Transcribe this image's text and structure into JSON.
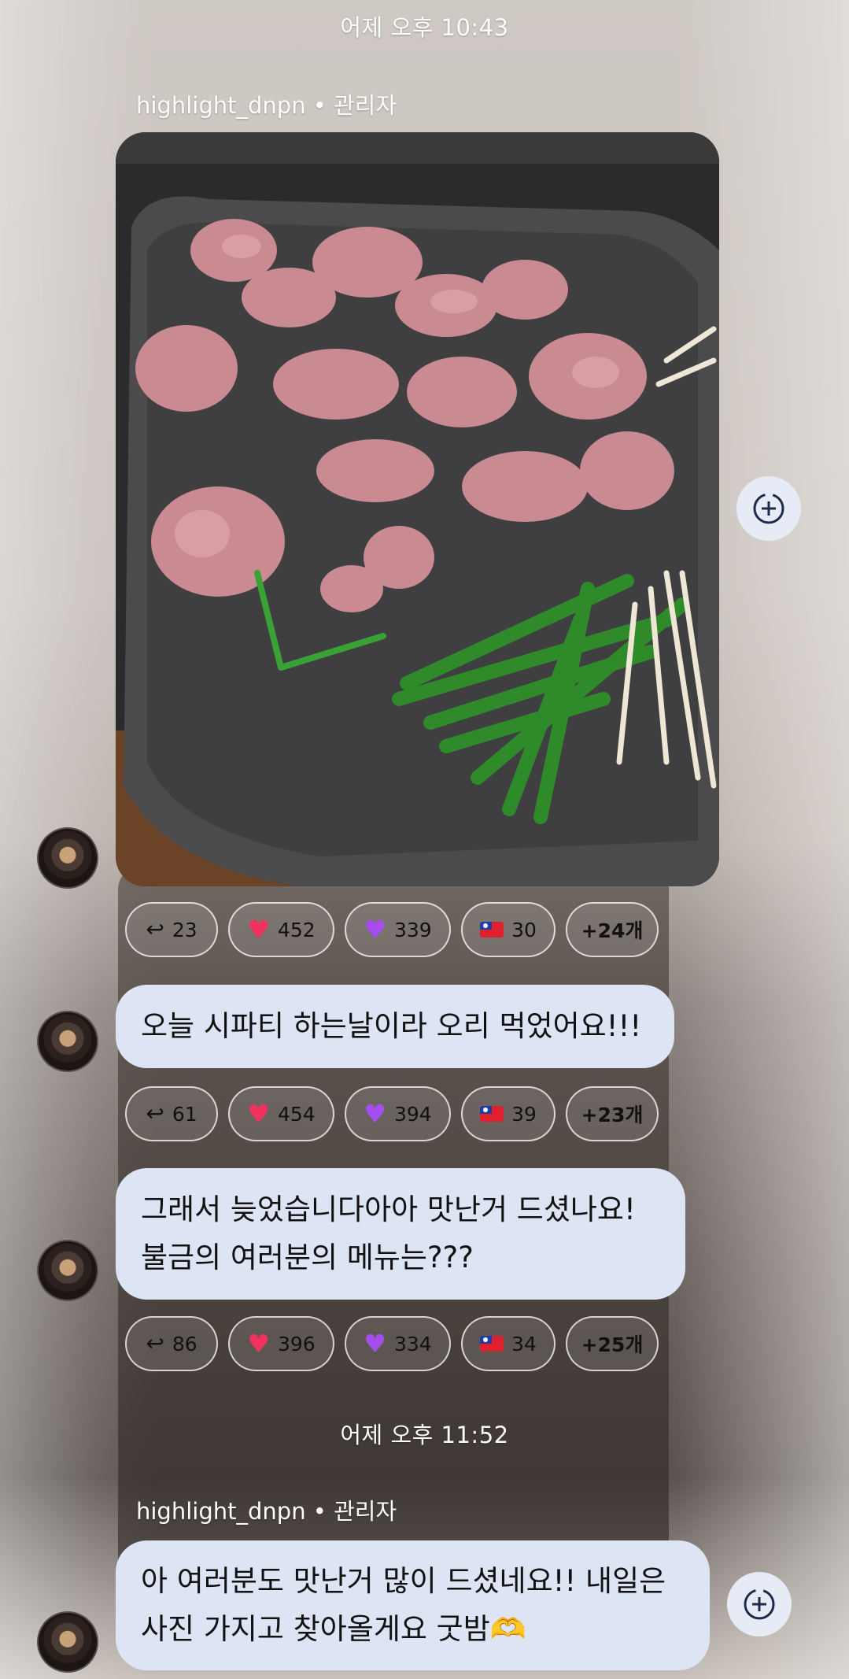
{
  "timestamps": {
    "first": "어제 오후 10:43",
    "second": "어제 오후 11:52"
  },
  "sender": {
    "label_1": "highlight_dnpn • 관리자",
    "label_2": "highlight_dnpn • 관리자"
  },
  "messages": [
    {
      "type": "image",
      "reactions": {
        "reply": "23",
        "heart": "452",
        "purple_heart": "339",
        "flag": "30",
        "more": "+24개"
      }
    },
    {
      "type": "text",
      "line1": "오늘 시파티 하는날이라 오리 먹었어요!!!",
      "reactions": {
        "reply": "61",
        "heart": "454",
        "purple_heart": "394",
        "flag": "39",
        "more": "+23개"
      }
    },
    {
      "type": "text",
      "line1": "그래서 늦었습니다아아 맛난거 드셨나요!",
      "line2": "불금의 여러분의 메뉴는???",
      "reactions": {
        "reply": "86",
        "heart": "396",
        "purple_heart": "334",
        "flag": "34",
        "more": "+25개"
      }
    },
    {
      "type": "text",
      "line1": "아 여러분도 맛난거 많이 드셨네요!! 내일은",
      "line2": "사진 가지고 찾아올게요 굿밤🫶"
    }
  ],
  "icons": {
    "reply": "reply-arrow-icon",
    "heart": "red-heart-icon",
    "purple_heart": "purple-heart-icon",
    "flag": "taiwan-flag-icon",
    "add_reaction": "add-reaction-icon"
  },
  "colors": {
    "bubble": "#dde4f4",
    "heart": "#f0325c",
    "purple_heart": "#a64df0"
  }
}
